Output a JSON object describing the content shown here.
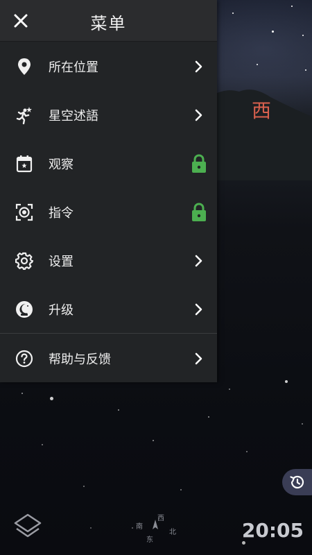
{
  "drawer": {
    "title": "菜单",
    "items": [
      {
        "label": "所在位置",
        "icon": "location-pin-icon",
        "right": "chevron-right-icon"
      },
      {
        "label": "星空述語",
        "icon": "runner-star-icon",
        "right": "chevron-right-icon"
      },
      {
        "label": "观察",
        "icon": "calendar-icon",
        "right": "lock-icon"
      },
      {
        "label": "指令",
        "icon": "target-frame-icon",
        "right": "lock-icon"
      },
      {
        "label": "设置",
        "icon": "gear-icon",
        "right": "chevron-right-icon"
      },
      {
        "label": "升级",
        "icon": "moon-plus-icon",
        "right": "chevron-right-icon"
      },
      {
        "label": "帮助与反馈",
        "icon": "help-circle-icon",
        "right": "chevron-right-icon"
      }
    ]
  },
  "sky": {
    "direction_label": "西"
  },
  "compass": {
    "north": "北",
    "south": "南",
    "east": "东",
    "west": "西"
  },
  "clock": {
    "time": "20:05"
  },
  "colors": {
    "drawer_bg": "#222426",
    "header_bg": "#2b2c2e",
    "lock_green": "#4caf50",
    "direction_red": "#d9604e"
  }
}
